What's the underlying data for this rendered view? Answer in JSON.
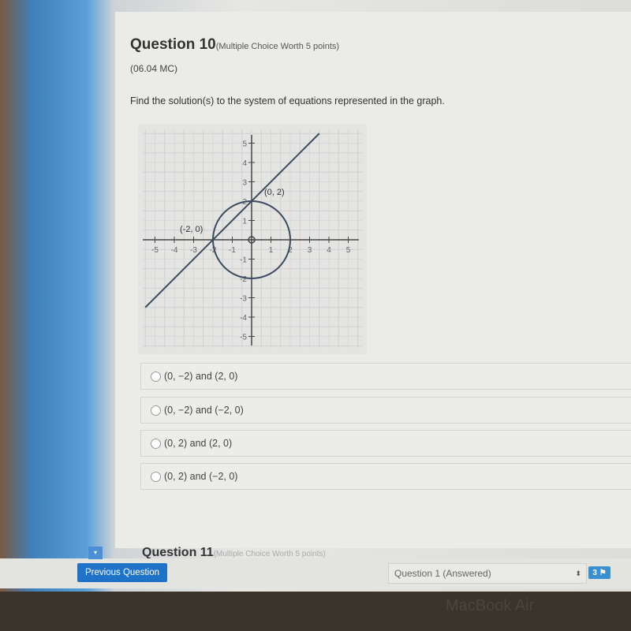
{
  "question": {
    "title": "Question 10",
    "meta": "(Multiple Choice Worth 5 points)",
    "code": "(06.04 MC)",
    "prompt": "Find the solution(s) to the system of equations represented in the graph."
  },
  "chart_data": {
    "type": "line",
    "xlim": [
      -5,
      5
    ],
    "ylim": [
      -5,
      5
    ],
    "grid": true,
    "x_ticks": [
      "-5",
      "-4",
      "-3",
      "-2",
      "-1",
      "1",
      "2",
      "3",
      "4",
      "5"
    ],
    "y_ticks": [
      "5",
      "4",
      "3",
      "2",
      "1",
      "-1",
      "-2",
      "-3",
      "-4",
      "-5"
    ],
    "series": [
      {
        "kind": "line",
        "equation": "y = x + 2",
        "x": [
          -5.5,
          3.5
        ],
        "y": [
          -3.5,
          5.5
        ]
      },
      {
        "kind": "circle",
        "equation": "x^2 + y^2 = 4",
        "center": [
          0,
          0
        ],
        "radius": 2
      }
    ],
    "annotations": [
      {
        "text": "(0, 2)",
        "x": 0,
        "y": 2
      },
      {
        "text": "(-2, 0)",
        "x": -2,
        "y": 0
      }
    ],
    "color": "#3d4a5c"
  },
  "options": [
    {
      "label": "(0, −2) and (2, 0)"
    },
    {
      "label": "(0, −2) and (−2, 0)"
    },
    {
      "label": "(0, 2) and (2, 0)"
    },
    {
      "label": "(0, 2) and (−2, 0)"
    }
  ],
  "next_question": {
    "title": "Question 11",
    "meta": "(Multiple Choice Worth 5 points)"
  },
  "footer": {
    "prev_label": "Previous Question",
    "select_value": "Question 1 (Answered)",
    "flag_count": "3",
    "accent": "#1e73c9"
  },
  "device_label": "MacBook Air"
}
